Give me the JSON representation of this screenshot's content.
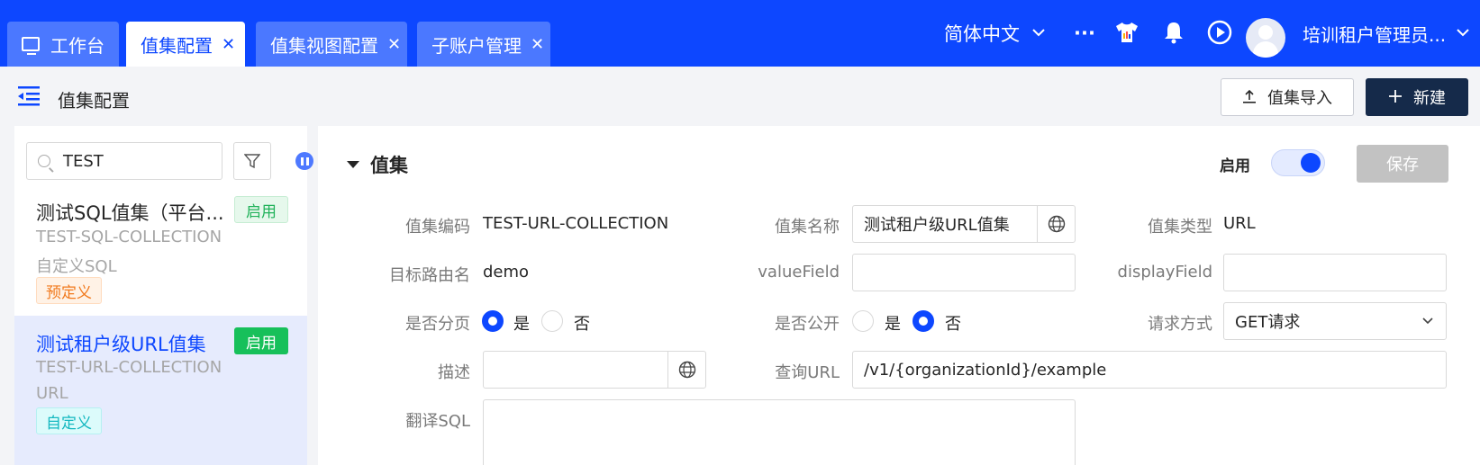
{
  "tabs": [
    {
      "label": "工作台",
      "icon": "monitor-icon",
      "closable": false
    },
    {
      "label": "值集配置",
      "active": true,
      "closable": true
    },
    {
      "label": "值集视图配置",
      "closable": true
    },
    {
      "label": "子账户管理",
      "closable": true
    }
  ],
  "close_glyph": "✕",
  "topbar": {
    "language": "简体中文",
    "more": "···",
    "username": "培训租户管理员..."
  },
  "header": {
    "title": "值集配置",
    "import_label": "值集导入",
    "new_label": "新建"
  },
  "sidebar": {
    "search_value": "TEST",
    "items": [
      {
        "name": "测试SQL值集（平台...",
        "status": "启用",
        "code": "TEST-SQL-COLLECTION",
        "type": "自定义SQL",
        "tag": "预定义"
      },
      {
        "name": "测试租户级URL值集",
        "status": "启用",
        "code": "TEST-URL-COLLECTION",
        "type": "URL",
        "tag": "自定义",
        "selected": true
      }
    ]
  },
  "form": {
    "section_title": "值集",
    "enable_label": "启用",
    "enabled": true,
    "save_label": "保存",
    "labels": {
      "code": "值集编码",
      "name": "值集名称",
      "type": "值集类型",
      "route": "目标路由名",
      "value_field": "valueField",
      "display_field": "displayField",
      "paged": "是否分页",
      "public": "是否公开",
      "method": "请求方式",
      "desc": "描述",
      "query_url": "查询URL",
      "translate_sql": "翻译SQL"
    },
    "values": {
      "code": "TEST-URL-COLLECTION",
      "name": "测试租户级URL值集",
      "type": "URL",
      "route": "demo",
      "value_field": "",
      "display_field": "",
      "method": "GET请求",
      "desc": "",
      "query_url": "/v1/{organizationId}/example",
      "translate_sql": ""
    },
    "yes": "是",
    "no": "否",
    "paged_value": "是",
    "public_value": "否"
  },
  "colors": {
    "brand": "#0d47ff",
    "topbar": "#0d47ff",
    "new_button": "#152a4a",
    "enabled_green": "#17c05a"
  }
}
